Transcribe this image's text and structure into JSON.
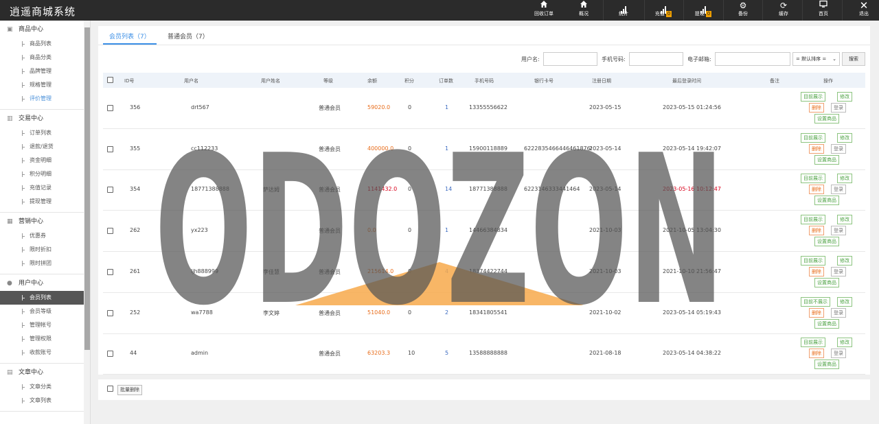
{
  "app": {
    "title": "逍遥商城系统"
  },
  "topbar": {
    "items": [
      {
        "label": "回收订单",
        "icon": "home-icon"
      },
      {
        "label": "概况",
        "icon": "home-icon"
      },
      {
        "label": "统计",
        "icon": "bar-chart-icon"
      },
      {
        "label": "充值",
        "icon": "bar-chart-icon",
        "badge": "0"
      },
      {
        "label": "提现",
        "icon": "bar-chart-icon",
        "badge": "0"
      },
      {
        "label": "备份",
        "icon": "gear-icon"
      },
      {
        "label": "缓存",
        "icon": "refresh-icon"
      },
      {
        "label": "首页",
        "icon": "monitor-icon"
      },
      {
        "label": "退出",
        "icon": "close-icon"
      }
    ]
  },
  "sidebar": {
    "groups": [
      {
        "title": "商品中心",
        "items": [
          "商品列表",
          "商品分类",
          "品牌管理",
          "规格管理",
          "评价管理"
        ]
      },
      {
        "title": "交易中心",
        "items": [
          "订单列表",
          "退款/退货",
          "资金明细",
          "积分明细",
          "充值记录",
          "提现管理"
        ]
      },
      {
        "title": "营销中心",
        "items": [
          "优惠券",
          "限时折扣",
          "限时拼团"
        ]
      },
      {
        "title": "用户中心",
        "items": [
          "会员列表",
          "会员等级",
          "管理帐号",
          "管理权限",
          "收款账号"
        ]
      },
      {
        "title": "文章中心",
        "items": [
          "文章分类",
          "文章列表"
        ]
      }
    ]
  },
  "tabs": [
    {
      "label": "会员列表（7）"
    },
    {
      "label": "普通会员（7）"
    }
  ],
  "filters": {
    "username_label": "用户名:",
    "phone_label": "手机号码:",
    "email_label": "电子邮箱:",
    "sort_value": "= 默认排序 =",
    "search_label": "搜索"
  },
  "table": {
    "headers": {
      "id": "ID号",
      "username": "用户名",
      "realname": "用户姓名",
      "level": "等级",
      "balance": "余额",
      "points": "积分",
      "orders": "订单数",
      "phone": "手机号码",
      "bank": "银行卡号",
      "regdate": "注册日期",
      "lastlogin": "最后登录时间",
      "remark": "备注",
      "action": "操作"
    },
    "rows": [
      {
        "id": "356",
        "username": "drt567",
        "realname": "",
        "level": "普通会员",
        "balance": "59020.0",
        "points": "0",
        "orders": "1",
        "phone": "13355556622",
        "bank": "",
        "regdate": "2023-05-15",
        "lastlogin": "2023-05-15 01:24:56",
        "show": "目前展示"
      },
      {
        "id": "355",
        "username": "cc112233",
        "realname": "",
        "level": "普通会员",
        "balance": "400000.0",
        "points": "0",
        "orders": "1",
        "phone": "15900118889",
        "bank": "6222835466446461876l",
        "regdate": "2023-05-14",
        "lastlogin": "2023-05-14 19:42:07",
        "show": "目前展示"
      },
      {
        "id": "354",
        "username": "18771388888",
        "realname": "萨达姆",
        "level": "普通会员",
        "balance": "1141432.0",
        "points": "0",
        "orders": "14",
        "phone": "18771388888",
        "bank": "6223146333441464",
        "regdate": "2023-05-14",
        "lastlogin": "2023-05-16 10:12:47",
        "show": "目前展示"
      },
      {
        "id": "262",
        "username": "yx223",
        "realname": "",
        "level": "普通会员",
        "balance": "0.0",
        "points": "0",
        "orders": "1",
        "phone": "14466384834",
        "bank": "",
        "regdate": "2021-10-03",
        "lastlogin": "2021-10-05 13:04:30",
        "show": "目前展示"
      },
      {
        "id": "261",
        "username": "ljh888999",
        "realname": "李佳慧",
        "level": "普通会员",
        "balance": "215614.0",
        "points": "0",
        "orders": "4",
        "phone": "18374422744",
        "bank": "",
        "regdate": "2021-10-03",
        "lastlogin": "2021-10-10 21:56:47",
        "show": "目前展示"
      },
      {
        "id": "252",
        "username": "wa7788",
        "realname": "李文婷",
        "level": "普通会员",
        "balance": "51040.0",
        "points": "0",
        "orders": "2",
        "phone": "18341805541",
        "bank": "",
        "regdate": "2021-10-02",
        "lastlogin": "2023-05-14 05:19:43",
        "show": "目前不展示"
      },
      {
        "id": "44",
        "username": "admin",
        "realname": "",
        "level": "普通会员",
        "balance": "63203.3",
        "points": "10",
        "orders": "5",
        "phone": "13588888888",
        "bank": "",
        "regdate": "2021-08-18",
        "lastlogin": "2023-05-14 04:38:22",
        "show": "目前展示"
      }
    ],
    "actions": {
      "edit": "修改",
      "delete": "删除",
      "login": "登录",
      "set_goods": "设置商品"
    }
  },
  "footer": {
    "batch_delete": "批量删除"
  },
  "watermark": {
    "text": "ODOZON"
  },
  "colors": {
    "topbar": "#2b2b2b",
    "accent": "#3a8ee6",
    "balance": "#e86c1a",
    "green": "#4aa140",
    "badge": "#f0a000"
  }
}
